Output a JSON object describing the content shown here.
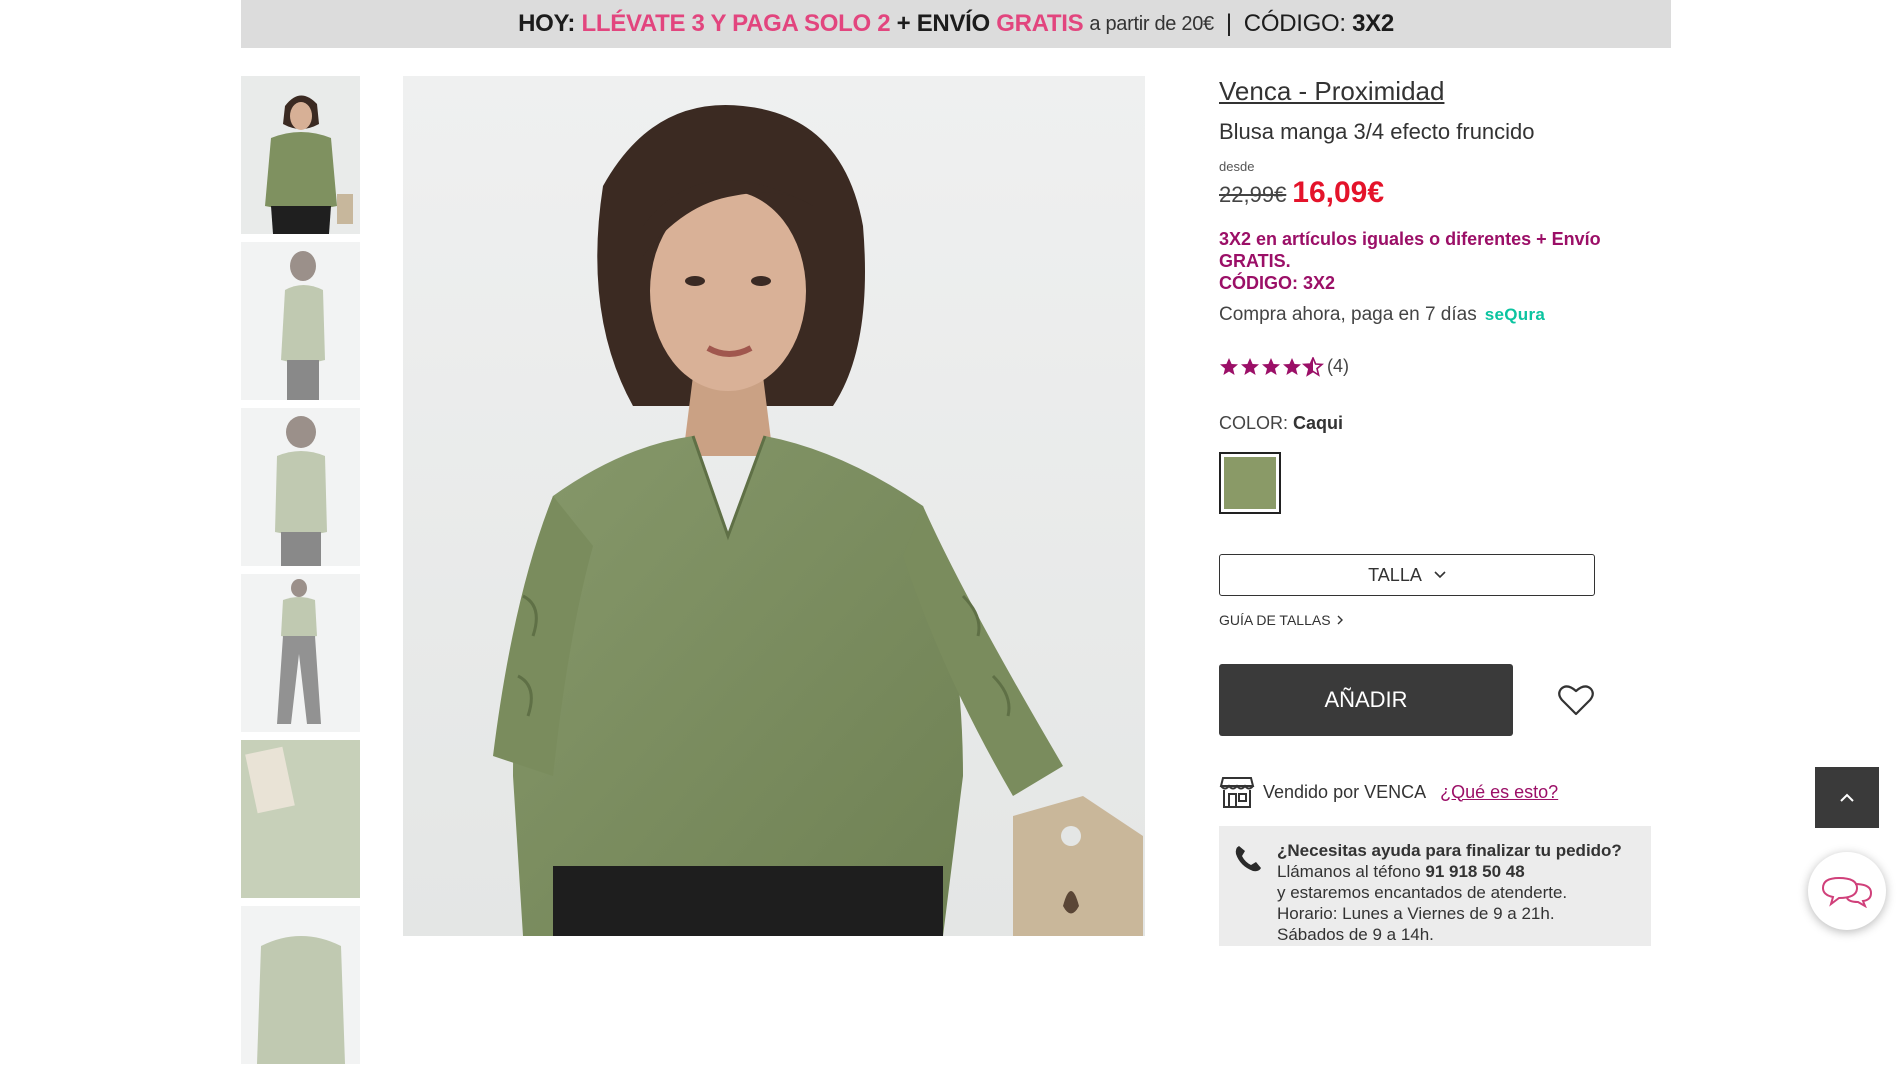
{
  "promo_banner": {
    "hoy": "HOY:",
    "offer": "LLÉVATE 3 Y PAGA SOLO 2",
    "plus": "+ ENVÍO",
    "gratis": "GRATIS",
    "condition": "a partir de 20€",
    "separator": "|",
    "code_label": "CÓDIGO:",
    "code": "3X2"
  },
  "product": {
    "brand": "Venca - Proximidad",
    "name": "Blusa manga 3/4 efecto fruncido",
    "price_prefix": "desde",
    "old_price": "22,99€",
    "new_price": "16,09€",
    "promo_line1": "3X2 en artículos iguales o diferentes + Envío GRATIS.",
    "promo_line2": "CÓDIGO: 3X2",
    "pay_later": "Compra ahora, paga en 7 días",
    "sequra_logo": "seQura",
    "rating_value": 4.5,
    "rating_count": "(4)",
    "color_label": "COLOR:",
    "color_value": "Caqui",
    "color_hex": "#8a9a67",
    "size_button": "TALLA",
    "size_guide": "GUÍA DE TALLAS",
    "add_button": "AÑADIR",
    "sold_by": "Vendido por VENCA",
    "what_is_this": "¿Qué es esto?"
  },
  "help_box": {
    "question": "¿Necesitas ayuda para finalizar tu pedido?",
    "call_text": "Llámanos al téfono",
    "phone": "91 918 50 48",
    "line3": "y estaremos encantados de atenderte.",
    "line4": "Horario: Lunes a Viernes de 9 a 21h.",
    "line5": "Sábados de 9 a 14h."
  },
  "colors": {
    "accent_pink": "#e2457e",
    "promo_purple": "#9b0f67",
    "sale_red": "#e4132a",
    "sequra_teal": "#0bc4a0",
    "button_dark": "#3a3a3a"
  },
  "icons": [
    "star-icon",
    "chevron-down-icon",
    "chevron-right-icon",
    "heart-icon",
    "store-icon",
    "phone-icon",
    "chevron-up-icon",
    "chat-icon"
  ]
}
